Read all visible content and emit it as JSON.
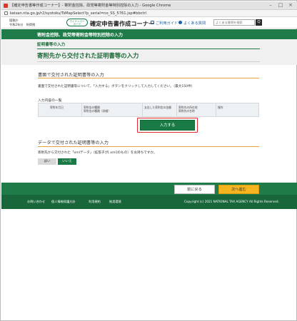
{
  "browser": {
    "window_title": "【確定申告書等作成コーナー】- 寄附金控除、政党等寄附金等特別控除の入力 - Google Chrome",
    "url": "keisan.nta.go.jp/r2/syotoku/TsMapSelect?p_serial=no_SS_5761.jsp#bbctrl"
  },
  "header": {
    "era_line1": "国税庁",
    "era_line2": "令和2年分　所得税",
    "myna_line1": "マイナンバー",
    "myna_line2": "カード",
    "site_title": "確定申告書作成コーナー",
    "guide_link": "ご利用ガイド",
    "faq_link": "よくある質問",
    "search_placeholder": "よくある質問を検索",
    "search_button": "Q"
  },
  "section_bar": {
    "title": "寄附金控除、政党等寄附金等特別控除の入力"
  },
  "page": {
    "breadcrumb": "証明書等の入力",
    "title": "寄附先から交付された証明書等の入力"
  },
  "paper_section": {
    "heading": "書面で交付された証明書等の入力",
    "description": "書面で交付された証明書等について、「入力する」ボタンをクリックして入力してください。（最大150件）",
    "list_heading": "入力内容の一覧",
    "columns": [
      {
        "line1": "寄附年月日",
        "line2": ""
      },
      {
        "line1": "寄附金の種類",
        "line2": "寄附金の種類（詳細）"
      },
      {
        "line1": "支出した寄附金の金額",
        "line2": ""
      },
      {
        "line1": "寄附先の所在地",
        "line2": "寄附先の名称"
      },
      {
        "line1": "操作",
        "line2": ""
      }
    ],
    "input_button": "入力する"
  },
  "data_section": {
    "heading": "データで交付された証明書等の入力",
    "question": "寄附先から交付された「xmlデータ」（拡張子が[.xml]のもの）をお持ちですか。",
    "yes_label": "はい",
    "no_label": "いいえ"
  },
  "nav": {
    "back_label": "前に戻る",
    "next_label": "次へ進む"
  },
  "footer": {
    "links": [
      "お問い合わせ",
      "個人情報保護方針",
      "利用規約",
      "推奨環境"
    ],
    "copyright": "Copyright (c) 2021 NATIONAL TAX AGENCY All Rights Reserved."
  },
  "colors": {
    "brand_green": "#1f7b47",
    "accent_orange": "#e6a23c",
    "next_yellow": "#f4b521",
    "highlight_red": "#e0282e"
  }
}
